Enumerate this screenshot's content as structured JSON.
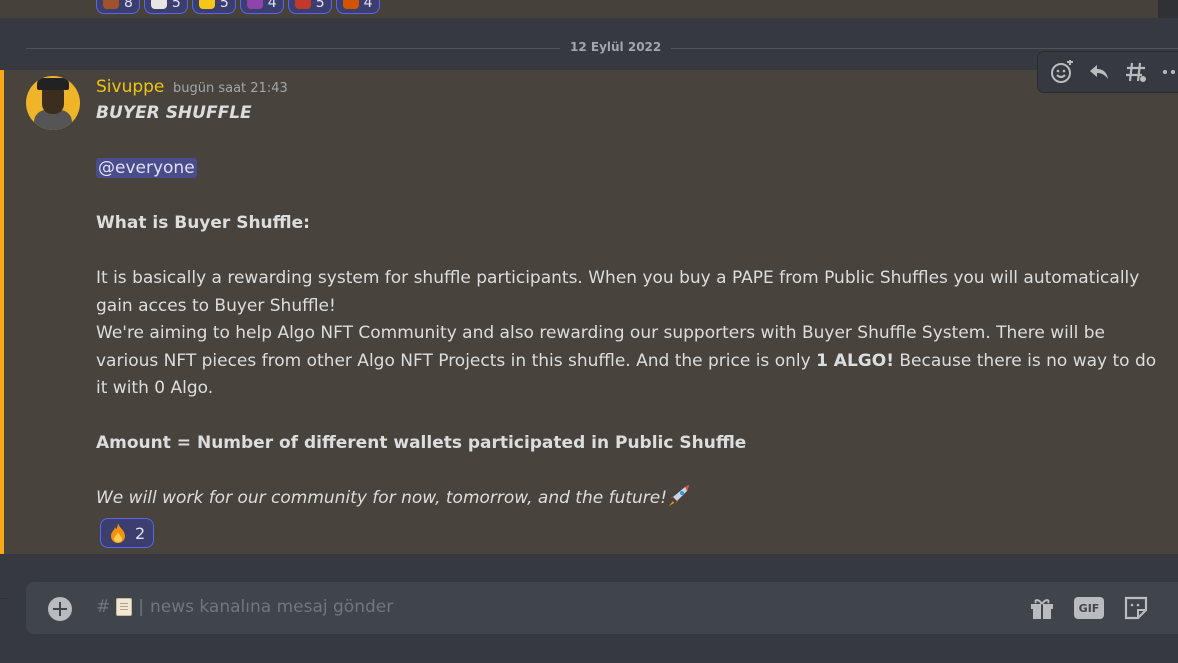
{
  "previous_reactions": [
    {
      "count": "8",
      "color": "#a0522d"
    },
    {
      "count": "5",
      "color": "#e6e6e6"
    },
    {
      "count": "5",
      "color": "#f5c518"
    },
    {
      "count": "4",
      "color": "#8e44ad"
    },
    {
      "count": "5",
      "color": "#c0392b"
    },
    {
      "count": "4",
      "color": "#d35400"
    }
  ],
  "date_divider": "12 Eylül 2022",
  "message": {
    "username": "Sivuppe",
    "timestamp": "bugün saat 21:43",
    "title": "BUYER SHUFFLE",
    "mention": "@everyone",
    "heading": "What is Buyer Shuffle:",
    "paragraph1": "It is basically a rewarding system for shuffle participants. When you buy a PAPE from Public Shuffles you will automatically gain acces to Buyer Shuffle!",
    "paragraph2_start": "We're aiming to help Algo NFT Community and also rewarding our supporters with Buyer Shuffle System. There will be various NFT pieces from other Algo NFT Projects in this shuffle. And the price is only ",
    "paragraph2_bold": "1 ALGO!",
    "paragraph2_end": " Because there is no way to do it with 0 Algo.",
    "amount_line": "Amount = Number of different wallets participated in Public Shuffle",
    "closing": "We will work for our community for now, tomorrow, and the future!",
    "reaction": {
      "emoji": "fire-icon",
      "count": "2"
    }
  },
  "hover_actions": [
    "add-reaction-icon",
    "reply-icon",
    "thread-icon",
    "more-icon"
  ],
  "composer": {
    "channel_prefix": "#",
    "placeholder": "news kanalına mesaj gönder",
    "gif_label": "GIF"
  },
  "colors": {
    "highlight_bar": "#faa81a",
    "username": "#f1c40f",
    "mention_bg": "#494d8a",
    "reaction_border": "#5865f2"
  }
}
